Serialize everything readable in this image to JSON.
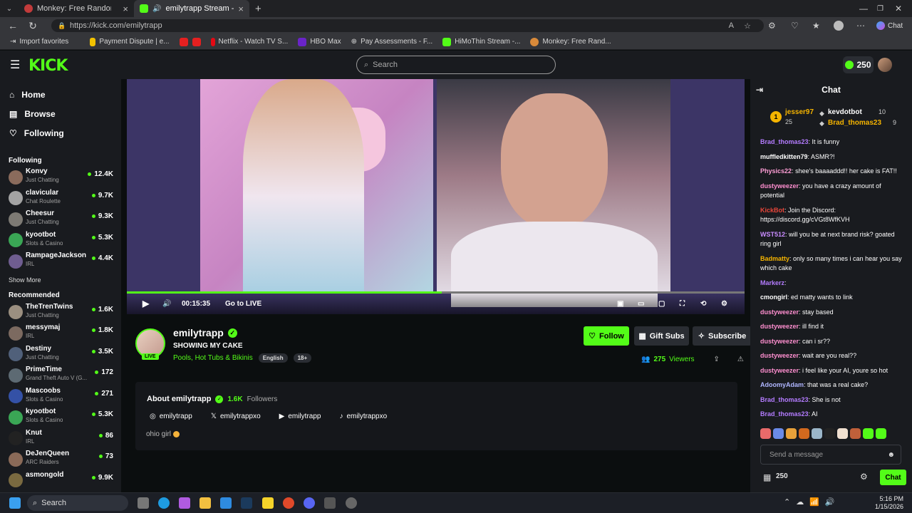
{
  "browser": {
    "tabs": [
      {
        "title": "Monkey: Free Random Video Chat",
        "active": false
      },
      {
        "title": "emilytrapp Stream - Watch Live",
        "active": true
      }
    ],
    "url": "https://kick.com/emilytrapp",
    "bookmarks": [
      "Import favorites",
      "Payment Dispute | e...",
      "Netflix - Watch TV S...",
      "HBO Max",
      "Pay Assessments - F...",
      "HiMoThin Stream -...",
      "Monkey: Free Rand..."
    ],
    "copilot": "Chat"
  },
  "header": {
    "logo": "KICK",
    "search_placeholder": "Search",
    "coins": "250"
  },
  "sidebar": {
    "nav": [
      {
        "label": "Home",
        "icon": "home-icon"
      },
      {
        "label": "Browse",
        "icon": "browse-icon"
      },
      {
        "label": "Following",
        "icon": "heart-icon"
      }
    ],
    "following_title": "Following",
    "following": [
      {
        "name": "Konvy",
        "category": "Just Chatting",
        "count": "12.4K",
        "color": "#8a6b5c"
      },
      {
        "name": "clavicular",
        "category": "Chat Roulette",
        "count": "9.7K",
        "color": "#a3a3a3"
      },
      {
        "name": "Cheesur",
        "category": "Just Chatting",
        "count": "9.3K",
        "color": "#7d7a74"
      },
      {
        "name": "kyootbot",
        "category": "Slots & Casino",
        "count": "5.3K",
        "color": "#3aa655"
      },
      {
        "name": "RampageJackson",
        "category": "IRL",
        "count": "4.4K",
        "color": "#6f5d90"
      }
    ],
    "show_more": "Show More",
    "recommended_title": "Recommended",
    "recommended": [
      {
        "name": "TheTrenTwins",
        "category": "Just Chatting",
        "count": "1.6K",
        "color": "#9b8f80"
      },
      {
        "name": "messymaj",
        "category": "IRL",
        "count": "1.8K",
        "color": "#7c6a60"
      },
      {
        "name": "Destiny",
        "category": "Just Chatting",
        "count": "3.5K",
        "color": "#50607a"
      },
      {
        "name": "PrimeTime",
        "category": "Grand Theft Auto V (G...",
        "count": "172",
        "color": "#5d6a73"
      },
      {
        "name": "Mascoobs",
        "category": "Slots & Casino",
        "count": "271",
        "color": "#3451a6"
      },
      {
        "name": "kyootbot",
        "category": "Slots & Casino",
        "count": "5.3K",
        "color": "#3aa655"
      },
      {
        "name": "Knut",
        "category": "IRL",
        "count": "86",
        "color": "#222"
      },
      {
        "name": "DeJenQueen",
        "category": "ARC Raiders",
        "count": "73",
        "color": "#8a6a58"
      },
      {
        "name": "asmongold",
        "category": "",
        "count": "9.9K",
        "color": "#7a6a40"
      }
    ]
  },
  "player": {
    "time": "00:15:35",
    "go_live": "Go to LIVE",
    "progress": 0.51
  },
  "channel": {
    "name": "emilytrapp",
    "live": "LIVE",
    "title": "SHOWING MY CAKE",
    "category": "Pools, Hot Tubs & Bikinis",
    "tags": [
      "English",
      "18+"
    ],
    "follow": "Follow",
    "gift_subs": "Gift Subs",
    "subscribe": "Subscribe",
    "viewers_count": "275",
    "viewers_label": "Viewers",
    "about_title": "About emilytrapp",
    "followers_count": "1.6K",
    "followers_label": "Followers",
    "socials": [
      {
        "icon": "instagram-icon",
        "label": "emilytrapp"
      },
      {
        "icon": "x-icon",
        "label": "emilytrappxo"
      },
      {
        "icon": "youtube-icon",
        "label": "emilytrapp"
      },
      {
        "icon": "tiktok-icon",
        "label": "emilytrappxo"
      }
    ],
    "bio": "ohio girl"
  },
  "chat": {
    "title": "Chat",
    "gifters": [
      {
        "rank": "1",
        "name": "jesser97",
        "count": "25"
      },
      {
        "name": "kevdotbot",
        "count": "10"
      },
      {
        "name": "Brad_thomas23",
        "count": "9"
      }
    ],
    "messages": [
      {
        "user": "Brad_thomas23",
        "color": "#b47cff",
        "text": "It is funny"
      },
      {
        "user": "muffledkitten79",
        "color": "#ffffff",
        "text": "ASMR?!"
      },
      {
        "user": "Physics22",
        "color": "#ff9ed6",
        "text": "shee's baaaaddd!! her cake is FAT!!"
      },
      {
        "user": "dustyweezer",
        "color": "#ff8fd0",
        "text": "you have a crazy amount of potential"
      },
      {
        "user": "KickBot",
        "color": "#e8463a",
        "text": "Join the Discord: https://discord.gg/cVGt8WfKVH"
      },
      {
        "user": "WST512",
        "color": "#c98cff",
        "text": "will you be at next brand risk? goated ring girl"
      },
      {
        "user": "Badmatty",
        "color": "#f5b400",
        "text": "only so many times i can hear you say which cake"
      },
      {
        "user": "Markerz",
        "color": "#b47cff",
        "text": ""
      },
      {
        "user": "cmongirl",
        "color": "#ffffff",
        "text": "ed matty wants to link"
      },
      {
        "user": "dustyweezer",
        "color": "#ff8fd0",
        "text": "stay based"
      },
      {
        "user": "dustyweezer",
        "color": "#ff8fd0",
        "text": "ill find it"
      },
      {
        "user": "dustyweezer",
        "color": "#ff8fd0",
        "text": "can i sr??"
      },
      {
        "user": "dustyweezer",
        "color": "#ff8fd0",
        "text": "wait are you real??"
      },
      {
        "user": "dustyweezer",
        "color": "#ff8fd0",
        "text": "i feel like your AI, youre so hot"
      },
      {
        "user": "AdoomyAdam",
        "color": "#b0b6ff",
        "text": "that was a real cake?"
      },
      {
        "user": "Brad_thomas23",
        "color": "#b47cff",
        "text": "She is not"
      },
      {
        "user": "Brad_thomas23",
        "color": "#b47cff",
        "text": "AI"
      }
    ],
    "input_placeholder": "Send a message",
    "points": "250",
    "send": "Chat"
  },
  "taskbar": {
    "search": "Search",
    "time": "5:16 PM",
    "date": "1/15/2026"
  },
  "colors": {
    "accent": "#53fc18",
    "bg": "#0b0e0f",
    "panel": "#191b1f"
  }
}
